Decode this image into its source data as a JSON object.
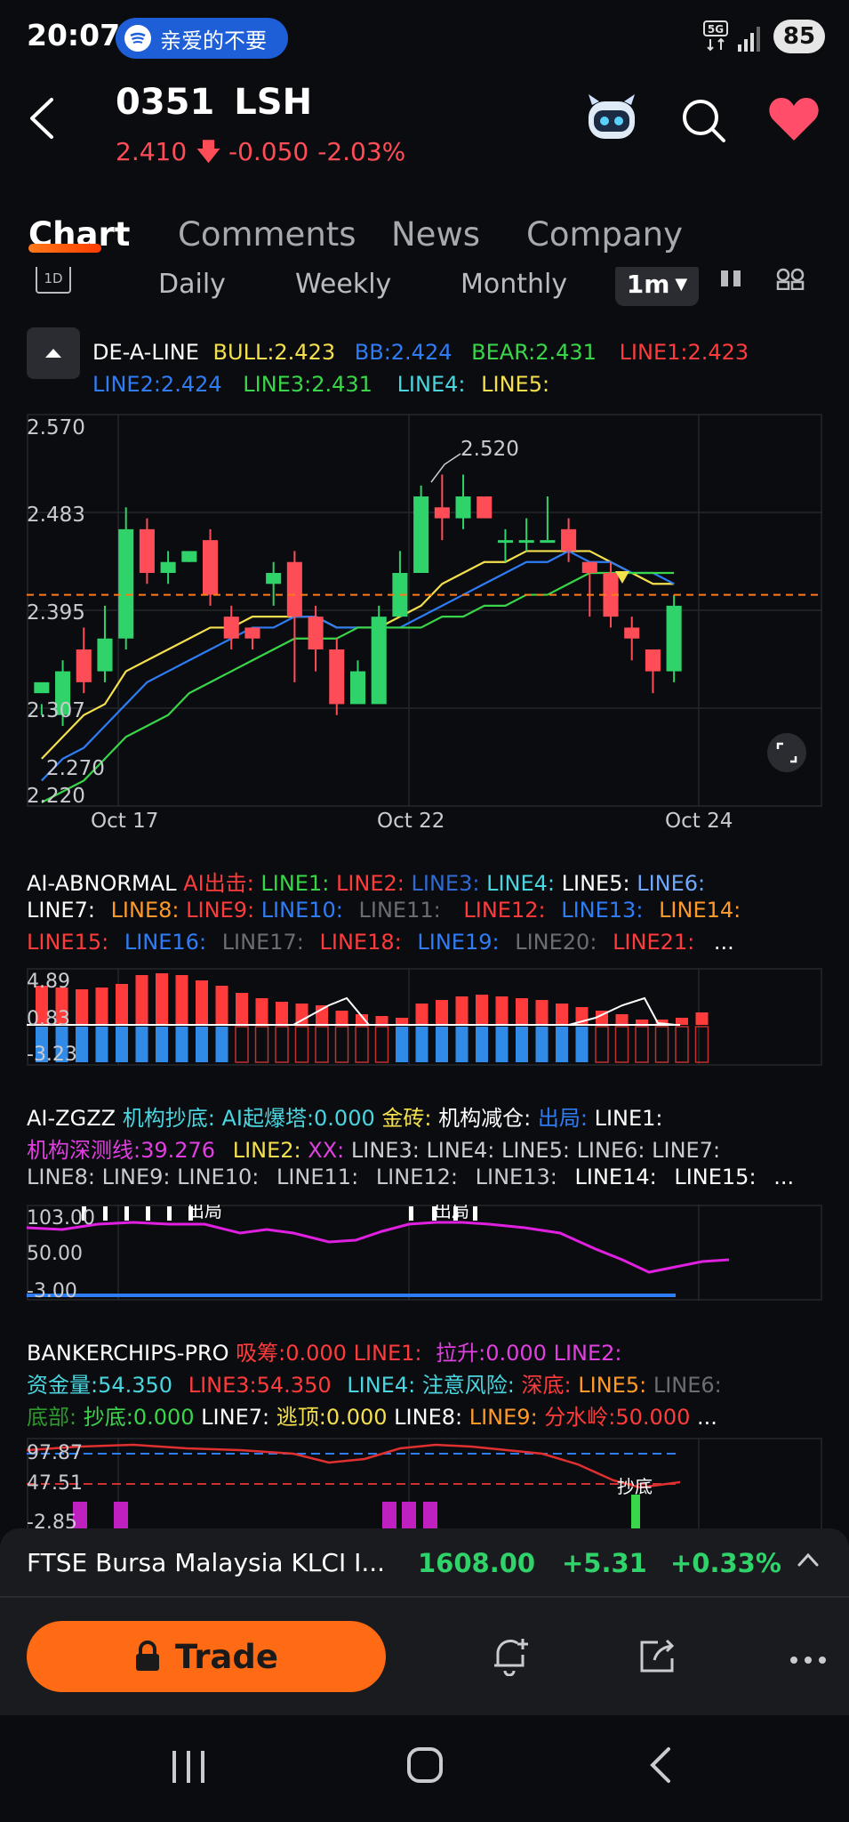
{
  "status": {
    "time": "20:07",
    "media_text": "亲爱的不要",
    "network": "5G",
    "battery": "85"
  },
  "header": {
    "code": "0351",
    "name": "LSH",
    "price": "2.410",
    "change": "-0.050",
    "change_pct": "-2.03%"
  },
  "tabs": [
    "Chart",
    "Comments",
    "News",
    "Company"
  ],
  "periods": {
    "day_icon": "1D",
    "daily": "Daily",
    "weekly": "Weekly",
    "monthly": "Monthly",
    "minute": "1m"
  },
  "main_legend": {
    "name": "DE-A-LINE",
    "bull": "BULL:2.423",
    "bb": "BB:2.424",
    "bear": "BEAR:2.431",
    "line1": "LINE1:2.423",
    "line2": "LINE2:2.424",
    "line3": "LINE3:2.431",
    "line4": "LINE4:",
    "line5": "LINE5:"
  },
  "chart": {
    "y_labels": [
      "2.570",
      "2.483",
      "2.395",
      "2.307",
      "2.220"
    ],
    "x_labels": [
      "Oct 17",
      "Oct 22",
      "Oct 24"
    ],
    "high_label": "2.520",
    "low_label": "2.270"
  },
  "chart_data": {
    "type": "candlestick",
    "ylim": [
      2.22,
      2.57
    ],
    "reference_line": 2.41,
    "candles": [
      [
        2.32,
        2.33,
        2.31,
        2.3
      ],
      [
        2.3,
        2.34,
        2.35,
        2.29
      ],
      [
        2.36,
        2.33,
        2.38,
        2.32
      ],
      [
        2.34,
        2.37,
        2.4,
        2.33
      ],
      [
        2.37,
        2.47,
        2.49,
        2.36
      ],
      [
        2.47,
        2.43,
        2.48,
        2.42
      ],
      [
        2.43,
        2.44,
        2.45,
        2.42
      ],
      [
        2.44,
        2.45,
        2.45,
        2.44
      ],
      [
        2.46,
        2.41,
        2.47,
        2.4
      ],
      [
        2.39,
        2.37,
        2.4,
        2.36
      ],
      [
        2.38,
        2.37,
        2.38,
        2.36
      ],
      [
        2.42,
        2.43,
        2.44,
        2.4
      ],
      [
        2.44,
        2.39,
        2.45,
        2.33
      ],
      [
        2.39,
        2.36,
        2.4,
        2.34
      ],
      [
        2.36,
        2.31,
        2.37,
        2.3
      ],
      [
        2.31,
        2.34,
        2.35,
        2.31
      ],
      [
        2.31,
        2.39,
        2.4,
        2.31
      ],
      [
        2.39,
        2.43,
        2.45,
        2.39
      ],
      [
        2.43,
        2.5,
        2.51,
        2.43
      ],
      [
        2.49,
        2.48,
        2.52,
        2.46
      ],
      [
        2.48,
        2.5,
        2.52,
        2.47
      ],
      [
        2.5,
        2.48,
        2.5,
        2.48
      ],
      [
        2.46,
        2.46,
        2.47,
        2.44
      ],
      [
        2.46,
        2.46,
        2.48,
        2.45
      ],
      [
        2.46,
        2.46,
        2.5,
        2.46
      ],
      [
        2.47,
        2.45,
        2.48,
        2.44
      ],
      [
        2.44,
        2.43,
        2.44,
        2.39
      ],
      [
        2.43,
        2.39,
        2.44,
        2.38
      ],
      [
        2.38,
        2.37,
        2.39,
        2.35
      ],
      [
        2.36,
        2.34,
        2.36,
        2.32
      ],
      [
        2.34,
        2.4,
        2.41,
        2.33
      ]
    ],
    "series": [
      {
        "name": "BULL",
        "color": "#f4e04d",
        "values": [
          2.26,
          2.28,
          2.3,
          2.31,
          2.34,
          2.35,
          2.36,
          2.37,
          2.38,
          2.38,
          2.39,
          2.39,
          2.39,
          2.39,
          2.38,
          2.38,
          2.38,
          2.39,
          2.4,
          2.42,
          2.43,
          2.44,
          2.44,
          2.45,
          2.45,
          2.45,
          2.45,
          2.44,
          2.43,
          2.42,
          2.42
        ]
      },
      {
        "name": "BB",
        "color": "#2f7df6",
        "values": [
          2.24,
          2.26,
          2.27,
          2.29,
          2.31,
          2.33,
          2.34,
          2.35,
          2.36,
          2.37,
          2.38,
          2.38,
          2.39,
          2.39,
          2.38,
          2.38,
          2.38,
          2.38,
          2.39,
          2.4,
          2.41,
          2.42,
          2.43,
          2.44,
          2.44,
          2.45,
          2.44,
          2.44,
          2.43,
          2.43,
          2.42
        ]
      },
      {
        "name": "BEAR",
        "color": "#3ad64a",
        "values": [
          2.22,
          2.23,
          2.24,
          2.26,
          2.28,
          2.29,
          2.3,
          2.32,
          2.33,
          2.34,
          2.35,
          2.36,
          2.37,
          2.37,
          2.37,
          2.38,
          2.38,
          2.38,
          2.38,
          2.39,
          2.39,
          2.4,
          2.4,
          2.41,
          2.41,
          2.42,
          2.43,
          2.43,
          2.43,
          2.43,
          2.43
        ]
      }
    ]
  },
  "ind1": {
    "name": "AI-ABNORMAL",
    "a": "AI出击:",
    "l1": "LINE1:",
    "l2": "LINE2:",
    "l3": "LINE3:",
    "l4": "LINE4:",
    "l5": "LINE5:",
    "l6": "LINE6:",
    "l7": "LINE7:",
    "l8": "LINE8:",
    "l9": "LINE9:",
    "l10": "LINE10:",
    "l11": "LINE11:",
    "l12": "LINE12:",
    "l13": "LINE13:",
    "l14": "LINE14:",
    "l15": "LINE15:",
    "l16": "LINE16:",
    "l17": "LINE17:",
    "l18": "LINE18:",
    "l19": "LINE19:",
    "l20": "LINE20:",
    "l21": "LINE21:",
    "more": "...",
    "y_labels": [
      "4.89",
      "0.83",
      "-3.23"
    ]
  },
  "ind2": {
    "name": "AI-ZGZZ",
    "a": "机构抄底:",
    "b": "AI起爆塔:0.000",
    "c": "金砖:",
    "d": "机构减仓:",
    "e": "出局:",
    "l1": "LINE1:",
    "f": "机构深测线:39.276",
    "l2": "LINE2:",
    "xx": "XX:",
    "l3": "LINE3:",
    "l4": "LINE4:",
    "l5": "LINE5:",
    "l6": "LINE6:",
    "l7": "LINE7:",
    "l8": "LINE8:",
    "l9": "LINE9:",
    "l10": "LINE10:",
    "l11": "LINE11:",
    "l12": "LINE12:",
    "l13": "LINE13:",
    "l14": "LINE14:",
    "l15": "LINE15:",
    "more": "...",
    "y_labels": [
      "103.00",
      "50.00",
      "-3.00"
    ],
    "tag": "出局"
  },
  "ind3": {
    "name": "BANKERCHIPS-PRO",
    "a": "吸筹:0.000",
    "l1": "LINE1:",
    "b": "拉升:0.000",
    "l2": "LINE2:",
    "c": "资金量:54.350",
    "l3": "LINE3:54.350",
    "l4": "LINE4:",
    "d": "注意风险:",
    "e": "深底:",
    "l5": "LINE5:",
    "l6": "LINE6:",
    "f": "底部:",
    "g": "抄底:0.000",
    "l7": "LINE7:",
    "h": "逃顶:0.000",
    "l8": "LINE8:",
    "l9": "LINE9:",
    "i": "分水岭:50.000",
    "more": "...",
    "y_labels": [
      "97.87",
      "47.51",
      "-2.85"
    ],
    "tag": "抄底"
  },
  "index_bar": {
    "name": "FTSE Bursa Malaysia KLCI I...",
    "value": "1608.00",
    "change": "+5.31",
    "pct": "+0.33%"
  },
  "actions": {
    "trade": "Trade"
  },
  "colors": {
    "up": "#2fd36a",
    "down": "#ff4d57",
    "accent": "#ff6b14"
  }
}
